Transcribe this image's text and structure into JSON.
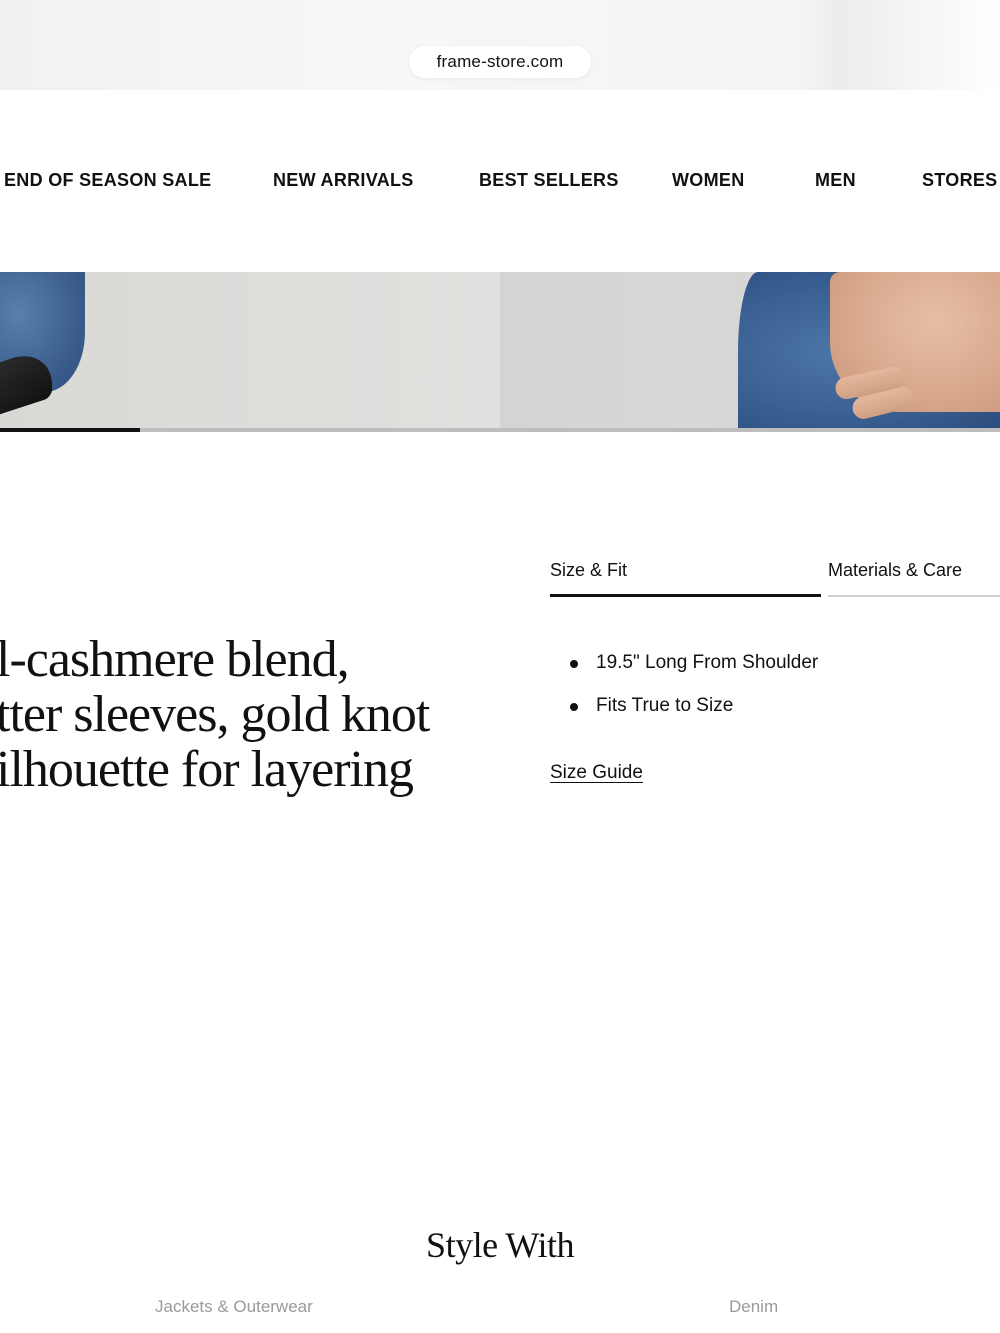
{
  "browser": {
    "url": "frame-store.com"
  },
  "nav": {
    "items": [
      {
        "label": "END OF SEASON SALE"
      },
      {
        "label": "NEW ARRIVALS"
      },
      {
        "label": "BEST SELLERS"
      },
      {
        "label": "WOMEN"
      },
      {
        "label": "MEN"
      },
      {
        "label": "STORES"
      }
    ]
  },
  "gallery": {
    "progress": 0.14
  },
  "description": {
    "lines": [
      "l-cashmere blend,",
      "tter sleeves, gold knot",
      "ilhouette for layering"
    ]
  },
  "details": {
    "tabs": [
      {
        "label": "Size & Fit",
        "active": true
      },
      {
        "label": "Materials & Care",
        "active": false
      }
    ],
    "bullets": [
      "19.5\" Long From Shoulder",
      "Fits True to Size"
    ],
    "size_guide_label": "Size Guide"
  },
  "style_with": {
    "title": "Style With",
    "categories": [
      "Jackets & Outerwear",
      "Denim"
    ]
  },
  "colors": {
    "text": "#111111",
    "muted": "#9a9a9a",
    "divider": "#cfcfcf"
  }
}
